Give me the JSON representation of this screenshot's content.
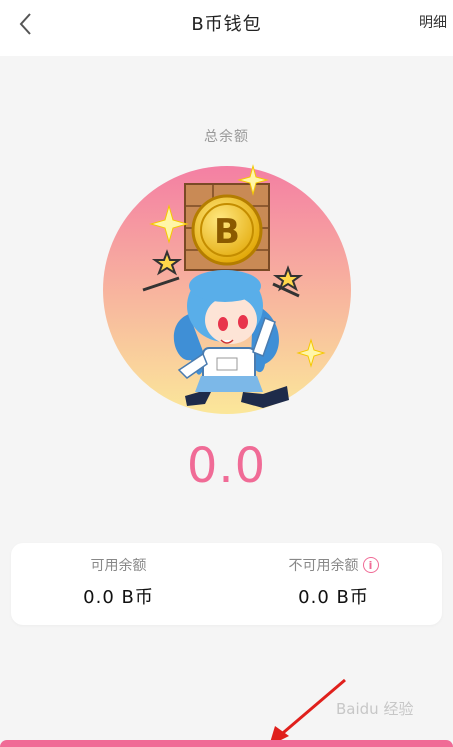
{
  "header": {
    "title": "B币钱包",
    "detail_label": "明细"
  },
  "wallet": {
    "total_label": "总余额",
    "total_amount": "0.0",
    "available_label": "可用余额",
    "available_amount": "0.0 B币",
    "unavailable_label": "不可用余额",
    "unavailable_amount": "0.0 B币"
  },
  "illustration": {
    "coin_letter": "B"
  },
  "watermark": {
    "text": "Baidu 经验"
  },
  "colors": {
    "accent": "#f06b96",
    "circle_top": "#f47fa3",
    "circle_bottom": "#fbe79a"
  },
  "icons": {
    "back": "chevron-left-icon",
    "info": "info-icon"
  }
}
